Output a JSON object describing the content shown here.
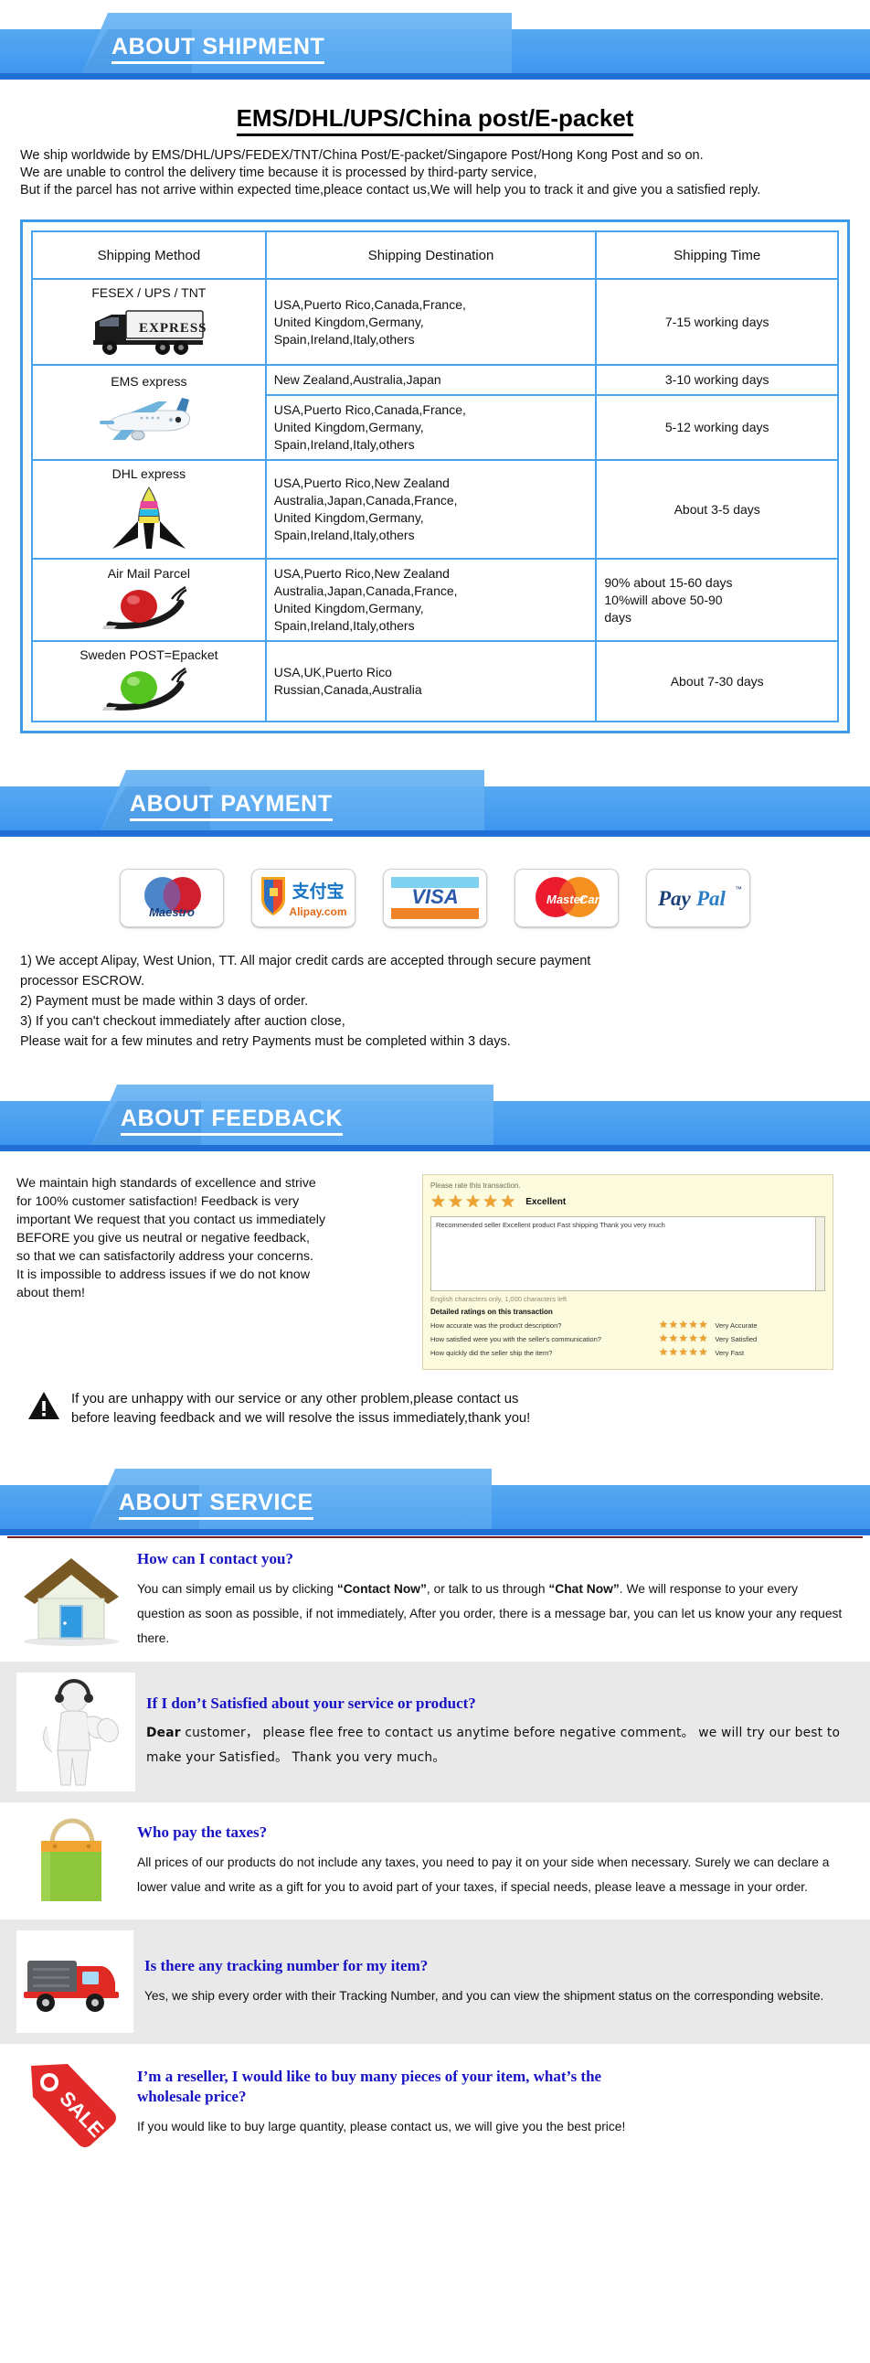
{
  "sections": {
    "shipment": {
      "banner_label": "ABOUT SHIPMENT",
      "title": "EMS/DHL/UPS/China post/E-packet",
      "paragraph": "We ship worldwide by EMS/DHL/UPS/FEDEX/TNT/China Post/E-packet/Singapore Post/Hong Kong Post and so on.\nWe are unable to control the delivery time because it is processed by third-party service,\nBut if the parcel has not arrive within expected time,pleace contact us,We will help you to track it and give you a satisfied reply.",
      "table": {
        "headers": [
          "Shipping Method",
          "Shipping Destination",
          "Shipping Time"
        ],
        "rows": [
          {
            "method": "FESEX / UPS / TNT",
            "icon": "truck-icon",
            "destination": "USA,Puerto Rico,Canada,France,\nUnited Kingdom,Germany,\nSpain,Ireland,Italy,others",
            "time": "7-15 working days"
          },
          {
            "method": "EMS express",
            "icon": "airplane-icon",
            "destination": "New Zealand,Australia,Japan",
            "time": "3-10 working days",
            "destination2": "USA,Puerto Rico,Canada,France,\nUnited Kingdom,Germany,\nSpain,Ireland,Italy,others",
            "time2": "5-12 working days"
          },
          {
            "method": "DHL express",
            "icon": "rocket-icon",
            "destination": "USA,Puerto Rico,New Zealand\nAustralia,Japan,Canada,France,\nUnited Kingdom,Germany,\nSpain,Ireland,Italy,others",
            "time": "About 3-5 days"
          },
          {
            "method": "Air Mail Parcel",
            "icon": "red-snail-icon",
            "destination": "USA,Puerto Rico,New Zealand\nAustralia,Japan,Canada,France,\nUnited Kingdom,Germany,\nSpain,Ireland,Italy,others",
            "time": "90% about 15-60 days\n10%will above 50-90\ndays"
          },
          {
            "method": "Sweden POST=Epacket",
            "icon": "green-snail-icon",
            "destination": "  USA,UK,Puerto Rico\n  Russian,Canada,Australia",
            "time": "About 7-30 days"
          }
        ]
      }
    },
    "payment": {
      "banner_label": "ABOUT PAYMENT",
      "logos": [
        "Maestro",
        "Alipay.com",
        "VISA",
        "MasterCard",
        "PayPal"
      ],
      "terms": "1) We accept Alipay, West Union, TT. All major credit cards are accepted through secure payment\n    processor ESCROW.\n2) Payment must be made within 3 days of order.\n3) If you can't checkout immediately after auction close,\n    Please wait for a few minutes and retry Payments must be completed within 3 days."
    },
    "feedback": {
      "banner_label": "ABOUT FEEDBACK",
      "text": "We maintain high standards of excellence and strive\nfor 100% customer satisfaction! Feedback is very\nimportant We request that you contact us immediately\nBEFORE you give us neutral or negative feedback,\nso that we can satisfactorily address your concerns.\nIt is impossible to address issues if we do not know\nabout them!",
      "screenshot": {
        "rate_prompt": "Please rate this transaction.",
        "rating_label": "Excellent",
        "comment": "Recommended seller Excellent product Fast shipping Thank you very much",
        "chars_left": "English characters only, 1,000 characters left",
        "detail_header": "Detailed ratings on this transaction",
        "rows": [
          {
            "question": "How accurate was the product description?",
            "value": "Very Accurate"
          },
          {
            "question": "How satisfied were you with the seller's communication?",
            "value": "Very Satisfied"
          },
          {
            "question": "How quickly did the seller ship the item?",
            "value": "Very Fast"
          }
        ]
      },
      "warning": "If you are unhappy with our service or any other problem,please contact us\nbefore leaving feedback and we will resolve the issus immediately,thank you!"
    },
    "service": {
      "banner_label": "ABOUT SERVICE",
      "items": [
        {
          "icon": "house-icon",
          "question": "How can I contact you?",
          "answer_parts": [
            {
              "t": "You can simply email us by clicking ",
              "b": false
            },
            {
              "t": "“Contact Now”",
              "b": true
            },
            {
              "t": ", or talk to us through ",
              "b": false
            },
            {
              "t": "“Chat Now”",
              "b": true
            },
            {
              "t": ". We will response to your every question as soon as possible, if not immediately, After you order, there is a message bar, you can let us know your any request there.",
              "b": false
            }
          ]
        },
        {
          "icon": "support-person-icon",
          "question": "If I don’t Satisfied about your service or product?",
          "answer_parts": [
            {
              "t": "Dear",
              "b": true
            },
            {
              "t": " customer， please flee free to contact us anytime before negative comment。 we will try our best to make your Satisfied。  Thank you very much。",
              "b": false
            }
          ]
        },
        {
          "icon": "shopping-bag-icon",
          "question": "Who pay the taxes?",
          "answer_parts": [
            {
              "t": " All prices of our products do not include any taxes, you need to pay it on your side when necessary. Surely we can declare a lower value and write as a gift for you to avoid part of your taxes, if special needs, please leave a message in your order.",
              "b": false
            }
          ]
        },
        {
          "icon": "delivery-truck-icon",
          "question": "Is there any tracking number for my item?",
          "answer_parts": [
            {
              "t": " Yes, we ship every order with their Tracking Number, and you can view the shipment status on the corresponding website.",
              "b": false
            }
          ]
        },
        {
          "icon": "sale-tag-icon",
          "question": "I’m a reseller, I would like to buy many pieces of your item, what’s the wholesale price?",
          "answer_parts": [
            {
              "t": " If you would like to buy large quantity, please contact us, we will give you the best price!",
              "b": false
            }
          ]
        }
      ]
    }
  },
  "colors": {
    "banner_blue": "#4a9ff0",
    "banner_underline": "#1f6fd6",
    "table_border": "#49a3ee",
    "heading_blue": "#1713c4",
    "alt_row_bg": "#e9e9e9",
    "star_orange": "#f0a22e",
    "sale_red": "#e03030"
  }
}
